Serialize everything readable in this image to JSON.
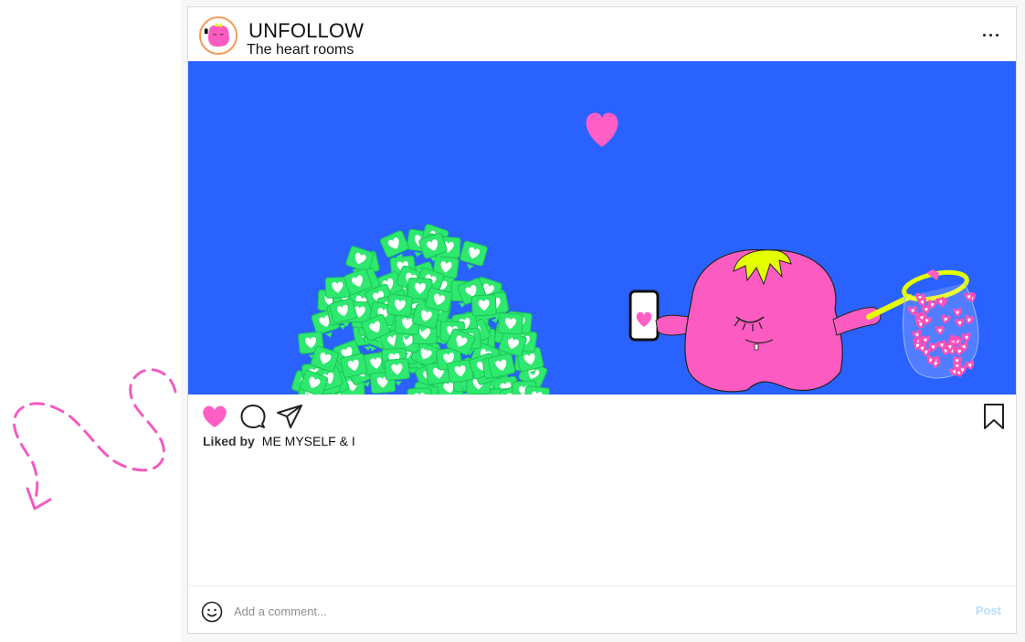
{
  "post": {
    "username": "UNFOLLOW",
    "location": "The heart rooms",
    "more_icon": "more-horizontal-icon",
    "liked_by_label": "Liked by",
    "liked_by_name": "ME MYSELF & I",
    "liked": true
  },
  "actions": {
    "like_icon": "heart-filled-icon",
    "comment_icon": "comment-bubble-icon",
    "share_icon": "paper-plane-icon",
    "save_icon": "bookmark-icon"
  },
  "comment": {
    "placeholder": "Add a comment...",
    "post_label": "Post",
    "emoji_icon": "smiley-icon"
  },
  "colors": {
    "media_background": "#2a62ff",
    "heart_pink": "#ff5ec4",
    "like_pile_green": "#2ee86f",
    "monster_pink": "#fc5cc1",
    "hair_yellow": "#e4ff00",
    "post_button_disabled": "#b9dffc",
    "doodle_pink": "#f25bc1"
  }
}
